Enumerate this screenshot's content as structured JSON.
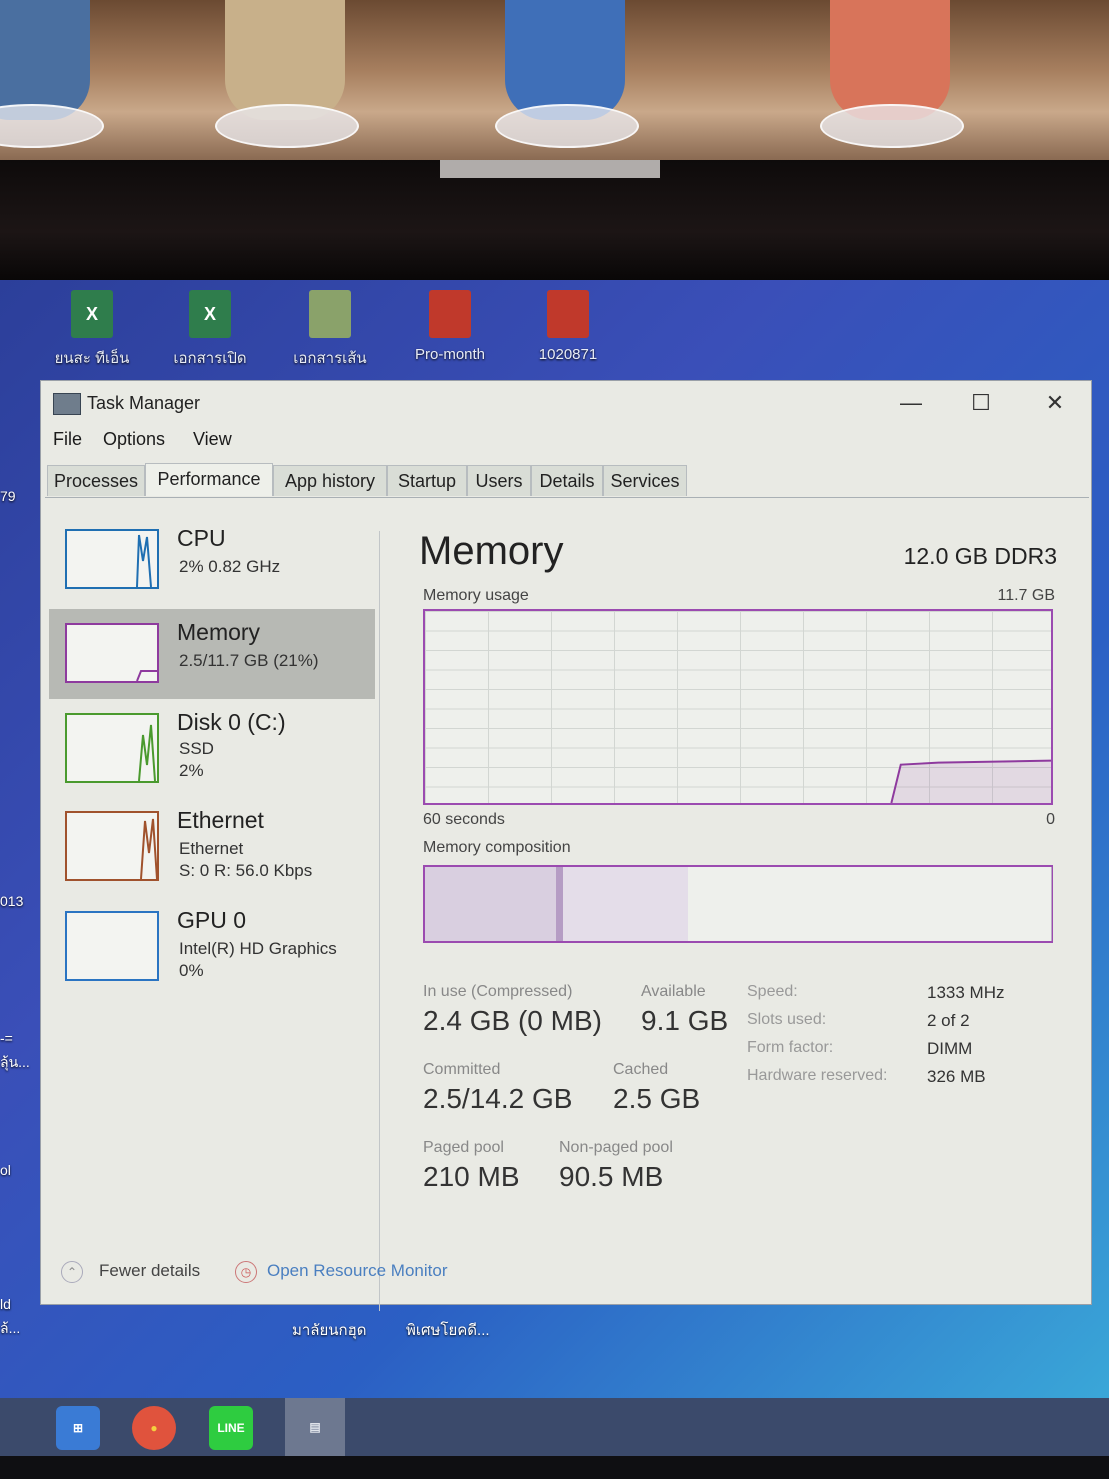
{
  "desktop_icons": [
    {
      "label": "ยนสะ ทีเอ็น",
      "type": "excel-icon",
      "color": "#2f7d4c",
      "glyph": "X"
    },
    {
      "label": "เอกสารเปิด",
      "type": "excel-icon",
      "color": "#2f7d4c",
      "glyph": "X"
    },
    {
      "label": "เอกสารเส้น",
      "type": "document-icon",
      "color": "#8aa26a",
      "glyph": ""
    },
    {
      "label": "Pro-month",
      "type": "pdf-icon",
      "color": "#c0392b",
      "glyph": ""
    },
    {
      "label": "1020871",
      "type": "pdf-icon",
      "color": "#c0392b",
      "glyph": ""
    }
  ],
  "desktop_edge_texts": [
    "79",
    "013",
    "-=",
    "ลุ้น...",
    "ol",
    "ld",
    "ล้..."
  ],
  "desktop_bottom_labels": [
    "มาลัยนกฮุด",
    "พิเศษโยคดี..."
  ],
  "window": {
    "title": "Task Manager",
    "controls": {
      "minimize": "—",
      "maximize": "☐",
      "close": "✕"
    }
  },
  "menu": [
    "File",
    "Options",
    "View"
  ],
  "tabs": [
    {
      "label": "Processes",
      "active": false
    },
    {
      "label": "Performance",
      "active": true
    },
    {
      "label": "App history",
      "active": false
    },
    {
      "label": "Startup",
      "active": false
    },
    {
      "label": "Users",
      "active": false
    },
    {
      "label": "Details",
      "active": false
    },
    {
      "label": "Services",
      "active": false
    }
  ],
  "sidebar": [
    {
      "title": "CPU",
      "sub1": "2% 0.82 GHz",
      "sub2": "",
      "sub3": "",
      "color": "#1f6fb2",
      "selected": false
    },
    {
      "title": "Memory",
      "sub1": "2.5/11.7 GB (21%)",
      "sub2": "",
      "sub3": "",
      "color": "#8e3a9e",
      "selected": true
    },
    {
      "title": "Disk 0 (C:)",
      "sub1": "SSD",
      "sub2": "2%",
      "sub3": "",
      "color": "#4a9a2e",
      "selected": false
    },
    {
      "title": "Ethernet",
      "sub1": "Ethernet",
      "sub2": "S: 0 R: 56.0 Kbps",
      "sub3": "",
      "color": "#a0522d",
      "selected": false
    },
    {
      "title": "GPU 0",
      "sub1": "Intel(R) HD Graphics",
      "sub2": "0%",
      "sub3": "",
      "color": "#2a74c2",
      "selected": false
    }
  ],
  "memory": {
    "title": "Memory",
    "total_type": "12.0 GB DDR3",
    "usage_label": "Memory usage",
    "usage_max": "11.7 GB",
    "time_label": "60 seconds",
    "time_end": "0",
    "composition_label": "Memory composition",
    "usage_fraction": 0.21,
    "composition": [
      {
        "name": "in-use",
        "fraction": 0.21,
        "color": "#d9cfe0"
      },
      {
        "name": "modified",
        "fraction": 0.01,
        "color": "#b59cc4"
      },
      {
        "name": "standby",
        "fraction": 0.2,
        "color": "#e4dde9"
      },
      {
        "name": "free",
        "fraction": 0.58,
        "color": "#eef0ec"
      }
    ],
    "stats": {
      "in_use_label": "In use (Compressed)",
      "in_use_value": "2.4 GB (0 MB)",
      "available_label": "Available",
      "available_value": "9.1 GB",
      "committed_label": "Committed",
      "committed_value": "2.5/14.2 GB",
      "cached_label": "Cached",
      "cached_value": "2.5 GB",
      "paged_label": "Paged pool",
      "paged_value": "210 MB",
      "nonpaged_label": "Non-paged pool",
      "nonpaged_value": "90.5 MB"
    },
    "specs": [
      {
        "label": "Speed:",
        "value": "1333 MHz"
      },
      {
        "label": "Slots used:",
        "value": "2 of 2"
      },
      {
        "label": "Form factor:",
        "value": "DIMM"
      },
      {
        "label": "Hardware reserved:",
        "value": "326 MB"
      }
    ]
  },
  "footer": {
    "fewer_details": "Fewer details",
    "resource_monitor": "Open Resource Monitor"
  },
  "taskbar": [
    {
      "name": "store-icon",
      "color": "#3a7bd5",
      "glyph": "⊞"
    },
    {
      "name": "chrome-icon",
      "color": "#e0533d",
      "glyph": "●"
    },
    {
      "name": "line-icon",
      "color": "#2ecc40",
      "glyph": "LINE"
    },
    {
      "name": "task-manager-taskbar-icon",
      "color": "#8b94a6",
      "glyph": "▤"
    }
  ]
}
